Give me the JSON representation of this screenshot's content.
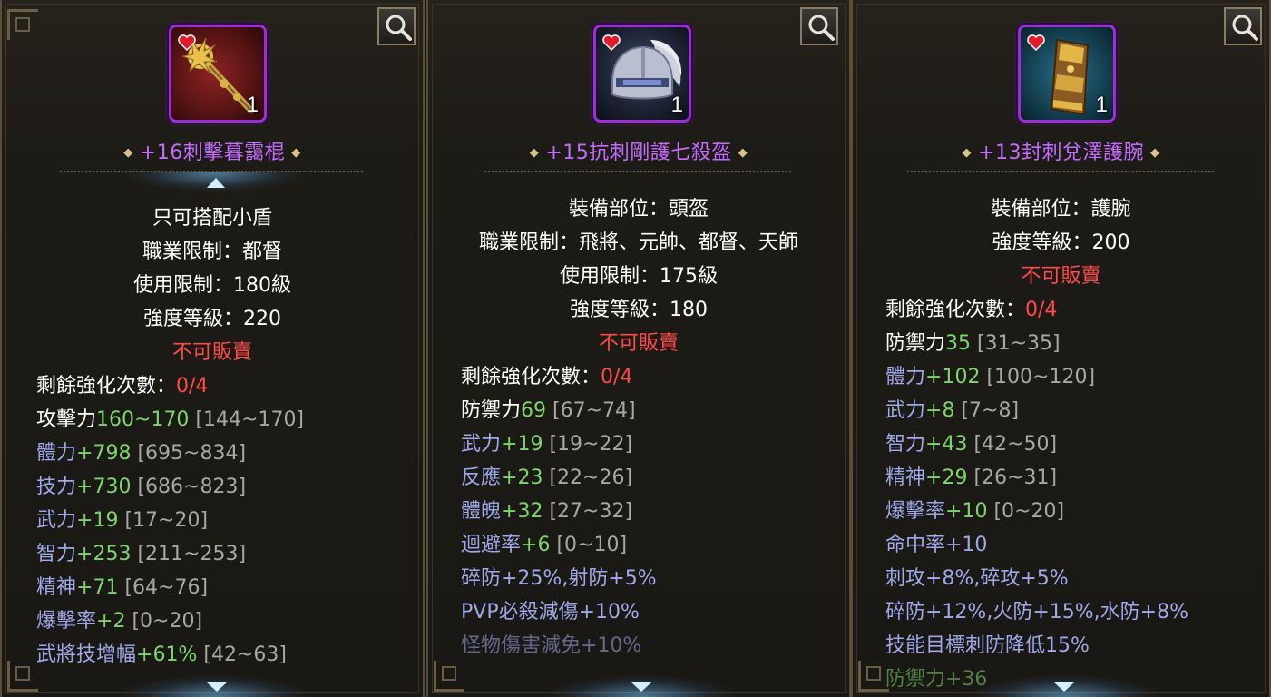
{
  "panels": [
    {
      "name": "+16刺擊暮靄棍",
      "quantity": "1",
      "info_lines": [
        "只可搭配小盾",
        "職業限制：都督",
        "使用限制：180級",
        "強度等級：220"
      ],
      "unsellable": "不可販賣",
      "refine_label": "剩餘強化次數：",
      "refine_value": "0/4",
      "stats": [
        {
          "label": "攻擊力",
          "value": "160~170",
          "range": "[144~170]"
        },
        {
          "label": "體力",
          "value": "+798",
          "range": "[695~834]"
        },
        {
          "label": "技力",
          "value": "+730",
          "range": "[686~823]"
        },
        {
          "label": "武力",
          "value": "+19",
          "range": "[17~20]"
        },
        {
          "label": "智力",
          "value": "+253",
          "range": "[211~253]"
        },
        {
          "label": "精神",
          "value": "+71",
          "range": "[64~76]"
        },
        {
          "label": "爆擊率",
          "value": "+2",
          "range": "[0~20]"
        },
        {
          "label": "武將技增幅",
          "value": "+61%",
          "range": "[42~63]"
        }
      ]
    },
    {
      "name": "+15抗刺剛護七殺盔",
      "quantity": "1",
      "info_lines": [
        "裝備部位：頭盔",
        "職業限制：飛將、元帥、都督、天師",
        "使用限制：175級",
        "強度等級：180"
      ],
      "unsellable": "不可販賣",
      "refine_label": "剩餘強化次數：",
      "refine_value": "0/4",
      "stats": [
        {
          "label": "防禦力",
          "value": "69",
          "range": "[67~74]"
        },
        {
          "label": "武力",
          "value": "+19",
          "range": "[19~22]"
        },
        {
          "label": "反應",
          "value": "+23",
          "range": "[22~26]"
        },
        {
          "label": "體魄",
          "value": "+32",
          "range": "[27~32]"
        },
        {
          "label": "迴避率",
          "value": "+6",
          "range": "[0~10]"
        }
      ],
      "extra_lines": [
        "碎防+25%,射防+5%",
        "PVP必殺減傷+10%",
        "怪物傷害減免+10%"
      ]
    },
    {
      "name": "+13封刺兌澤護腕",
      "quantity": "1",
      "info_lines": [
        "裝備部位：護腕",
        "強度等級：200"
      ],
      "unsellable": "不可販賣",
      "refine_label": "剩餘強化次數：",
      "refine_value": "0/4",
      "stats": [
        {
          "label": "防禦力",
          "value": "35",
          "range": "[31~35]"
        },
        {
          "label": "體力",
          "value": "+102",
          "range": "[100~120]"
        },
        {
          "label": "武力",
          "value": "+8",
          "range": "[7~8]"
        },
        {
          "label": "智力",
          "value": "+43",
          "range": "[42~50]"
        },
        {
          "label": "精神",
          "value": "+29",
          "range": "[26~31]"
        },
        {
          "label": "爆擊率",
          "value": "+10",
          "range": "[0~20]"
        }
      ],
      "extra_lines": [
        "命中率+10",
        "刺攻+8%,碎攻+5%",
        "碎防+12%,火防+15%,水防+8%",
        "技能目標刺防降低15%"
      ],
      "cut_line": "防禦力+36"
    }
  ]
}
